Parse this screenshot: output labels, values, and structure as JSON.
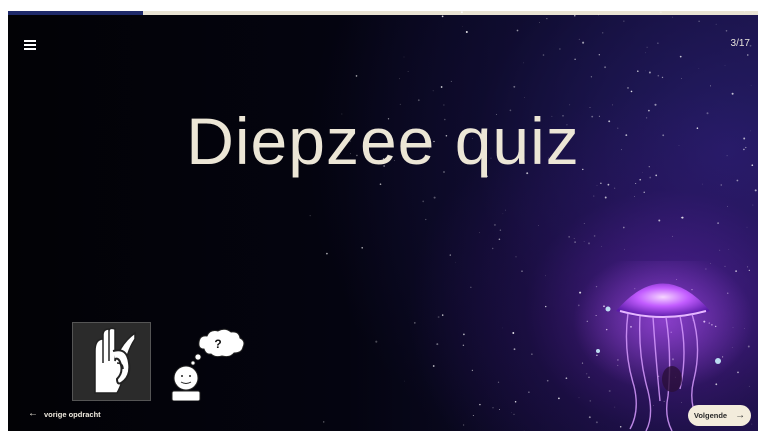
{
  "progress": {
    "fraction": 0.18
  },
  "header": {
    "menu_icon": "hamburger-menu-icon",
    "counter": "3/17"
  },
  "main": {
    "title": "Diepzee quiz",
    "pictograms": [
      "listen-ear-icon",
      "thinking-question-icon"
    ]
  },
  "footer": {
    "prev_label": "vorige opdracht",
    "prev_icon": "arrow-left-icon",
    "next_label": "Volgende",
    "next_icon": "arrow-right-icon"
  },
  "colors": {
    "title": "#ece6d6",
    "progress_track": "#e9e3d3",
    "progress_fill": "#1f2a6a",
    "next_button_bg": "#f3ecdc",
    "jellyfish": "#b04cff"
  }
}
